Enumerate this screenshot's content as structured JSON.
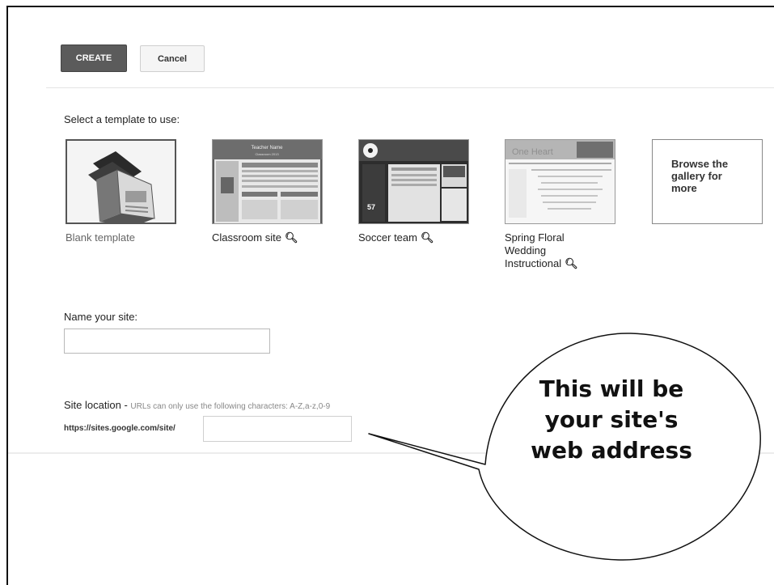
{
  "toolbar": {
    "create_label": "CREATE",
    "cancel_label": "Cancel"
  },
  "templates": {
    "heading": "Select a template to use:",
    "items": [
      {
        "label": "Blank template",
        "has_preview": false
      },
      {
        "label": "Classroom site",
        "has_preview": true
      },
      {
        "label": "Soccer team",
        "has_preview": true
      },
      {
        "label_lines": [
          "Spring Floral",
          "Wedding",
          "Instructional"
        ],
        "has_preview": true
      }
    ],
    "thumb_text": {
      "classroom_banner": [
        "Teacher Name",
        "Classroom 2013"
      ],
      "soccer_score": "57",
      "wedding_banner": "One Heart"
    },
    "browse_label": [
      "Browse the",
      "gallery for",
      "more"
    ],
    "preview_icon": "magnifier-icon"
  },
  "name_site": {
    "label": "Name your site:",
    "value": ""
  },
  "site_location": {
    "label": "Site location",
    "separator": " - ",
    "hint": "URLs can only use the following characters: A-Z,a-z,0-9",
    "url_prefix": "https://sites.google.com/site/",
    "value": ""
  },
  "callout": {
    "lines": [
      "This will be",
      "your site's",
      "web address"
    ]
  }
}
